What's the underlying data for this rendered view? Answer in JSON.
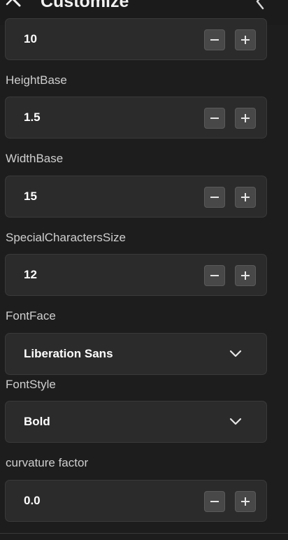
{
  "header": {
    "title": "Customize",
    "icon": "magic-wand-icon",
    "collapse_icon": "chevron-left-icon"
  },
  "fields": {
    "top_value": "10",
    "height_base": {
      "label": "HeightBase",
      "value": "1.5"
    },
    "width_base": {
      "label": "WidthBase",
      "value": "15"
    },
    "special_characters_size": {
      "label": "SpecialCharactersSize",
      "value": "12"
    },
    "font_face": {
      "label": "FontFace",
      "value": "Liberation Sans"
    },
    "font_style": {
      "label": "FontStyle",
      "value": "Bold"
    },
    "curvature_factor": {
      "label": "curvature factor",
      "value": "0.0"
    }
  },
  "colors": {
    "background": "#1d1d1d",
    "field_bg": "#2b2b2b",
    "button_bg": "#484848",
    "label_text": "#cfcfcf",
    "value_text": "#ffffff"
  }
}
